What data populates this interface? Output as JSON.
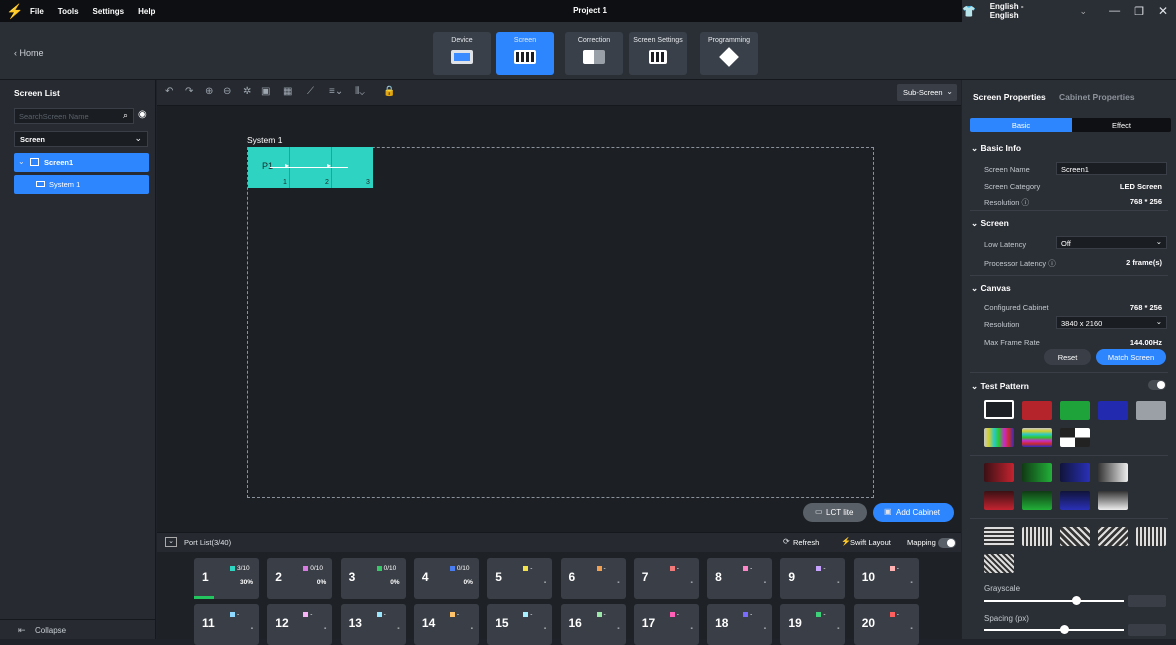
{
  "menu": {
    "items": [
      "File",
      "Tools",
      "Settings",
      "Help"
    ],
    "project_title": "Project 1",
    "language": "English - English"
  },
  "nav": {
    "home": "Home",
    "buttons": [
      {
        "label": "Device"
      },
      {
        "label": "Screen"
      },
      {
        "label": "Correction"
      },
      {
        "label": "Screen Settings"
      },
      {
        "label": "Programming"
      }
    ]
  },
  "left": {
    "title": "Screen List",
    "search_placeholder": "SearchScreen Name",
    "filter": "Screen",
    "tree": [
      {
        "label": "Screen1"
      },
      {
        "label": "System 1"
      }
    ],
    "collapse": "Collapse"
  },
  "canvas": {
    "sub_screen": "Sub-Screen",
    "system_label": "System 1",
    "port_label": "P1",
    "cabinets": [
      "1",
      "2",
      "3"
    ],
    "lct_button": "LCT lite",
    "add_cabinet": "Add Cabinet"
  },
  "port_list": {
    "title": "Port List(3/40)",
    "refresh": "Refresh",
    "swift_layout": "Swift Layout",
    "mapping": "Mapping",
    "ports": [
      {
        "n": "1",
        "count": "3/10",
        "pct": "30%",
        "color": "#2fd6c2",
        "progress": 0.3
      },
      {
        "n": "2",
        "count": "0/10",
        "pct": "0%",
        "color": "#d77be0"
      },
      {
        "n": "3",
        "count": "0/10",
        "pct": "0%",
        "color": "#38c768"
      },
      {
        "n": "4",
        "count": "0/10",
        "pct": "0%",
        "color": "#4a7df0"
      },
      {
        "n": "5",
        "count": "-",
        "pct": "-",
        "color": "#f3e24a"
      },
      {
        "n": "6",
        "count": "-",
        "pct": "-",
        "color": "#f0a050"
      },
      {
        "n": "7",
        "count": "-",
        "pct": "-",
        "color": "#f07a7a"
      },
      {
        "n": "8",
        "count": "-",
        "pct": "-",
        "color": "#ff86c8"
      },
      {
        "n": "9",
        "count": "-",
        "pct": "-",
        "color": "#c7a2ff"
      },
      {
        "n": "10",
        "count": "-",
        "pct": "-",
        "color": "#ffb0b0"
      },
      {
        "n": "11",
        "count": "-",
        "pct": "-",
        "color": "#8fd8ff"
      },
      {
        "n": "12",
        "count": "-",
        "pct": "-",
        "color": "#f7b3f5"
      },
      {
        "n": "13",
        "count": "-",
        "pct": "-",
        "color": "#9ae8ff"
      },
      {
        "n": "14",
        "count": "-",
        "pct": "-",
        "color": "#ffc46b"
      },
      {
        "n": "15",
        "count": "-",
        "pct": "-",
        "color": "#a6f0ff"
      },
      {
        "n": "16",
        "count": "-",
        "pct": "-",
        "color": "#9ce8a8"
      },
      {
        "n": "17",
        "count": "-",
        "pct": "-",
        "color": "#ff5fb4"
      },
      {
        "n": "18",
        "count": "-",
        "pct": "-",
        "color": "#7a6cff"
      },
      {
        "n": "19",
        "count": "-",
        "pct": "-",
        "color": "#3ed17a"
      },
      {
        "n": "20",
        "count": "-",
        "pct": "-",
        "color": "#ff5f5f"
      }
    ]
  },
  "right": {
    "tabs": [
      "Screen Properties",
      "Cabinet Properties"
    ],
    "subtabs": [
      "Basic",
      "Effect"
    ],
    "basic_info": {
      "title": "Basic Info",
      "screen_name_label": "Screen Name",
      "screen_name": "Screen1",
      "category_label": "Screen Category",
      "category": "LED Screen",
      "resolution_label": "Resolution",
      "resolution": "768 * 256"
    },
    "screen": {
      "title": "Screen",
      "low_latency_label": "Low Latency",
      "low_latency": "Off",
      "processor_latency_label": "Processor Latency",
      "processor_latency": "2 frame(s)"
    },
    "canvas": {
      "title": "Canvas",
      "configured_label": "Configured Cabinet",
      "configured": "768 * 256",
      "resolution_label": "Resolution",
      "resolution": "3840 x 2160",
      "frame_rate_label": "Max Frame Rate",
      "frame_rate": "144.00Hz",
      "reset": "Reset",
      "match": "Match Screen"
    },
    "test_pattern": {
      "title": "Test Pattern",
      "grayscale": "Grayscale",
      "spacing": "Spacing (px)"
    }
  }
}
